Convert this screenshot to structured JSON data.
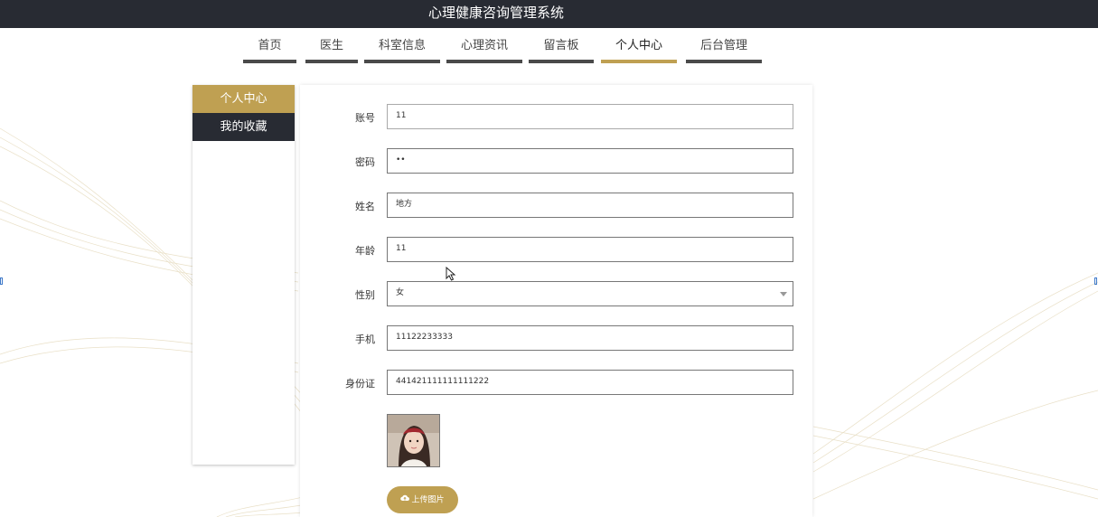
{
  "header": {
    "title": "心理健康咨询管理系统"
  },
  "nav": {
    "items": [
      {
        "label": "首页"
      },
      {
        "label": "医生"
      },
      {
        "label": "科室信息"
      },
      {
        "label": "心理资讯"
      },
      {
        "label": "留言板"
      },
      {
        "label": "个人中心",
        "active": true
      },
      {
        "label": "后台管理"
      }
    ]
  },
  "sidebar": {
    "items": [
      {
        "label": "个人中心",
        "active": true
      },
      {
        "label": "我的收藏"
      }
    ]
  },
  "form": {
    "account": {
      "label": "账号",
      "value": "11"
    },
    "password": {
      "label": "密码",
      "value": "••"
    },
    "name": {
      "label": "姓名",
      "value": "地方"
    },
    "age": {
      "label": "年龄",
      "value": "11"
    },
    "gender": {
      "label": "性别",
      "value": "女"
    },
    "phone": {
      "label": "手机",
      "value": "11122233333"
    },
    "id_card": {
      "label": "身份证",
      "value": "441421111111111222"
    },
    "upload_label": "上传图片"
  },
  "icons": {
    "upload": "cloud-upload-icon",
    "select": "chevron-down-icon"
  },
  "colors": {
    "accent": "#bfa052",
    "header_bg": "#282b33",
    "nav_underline": "#4a4a4a"
  }
}
